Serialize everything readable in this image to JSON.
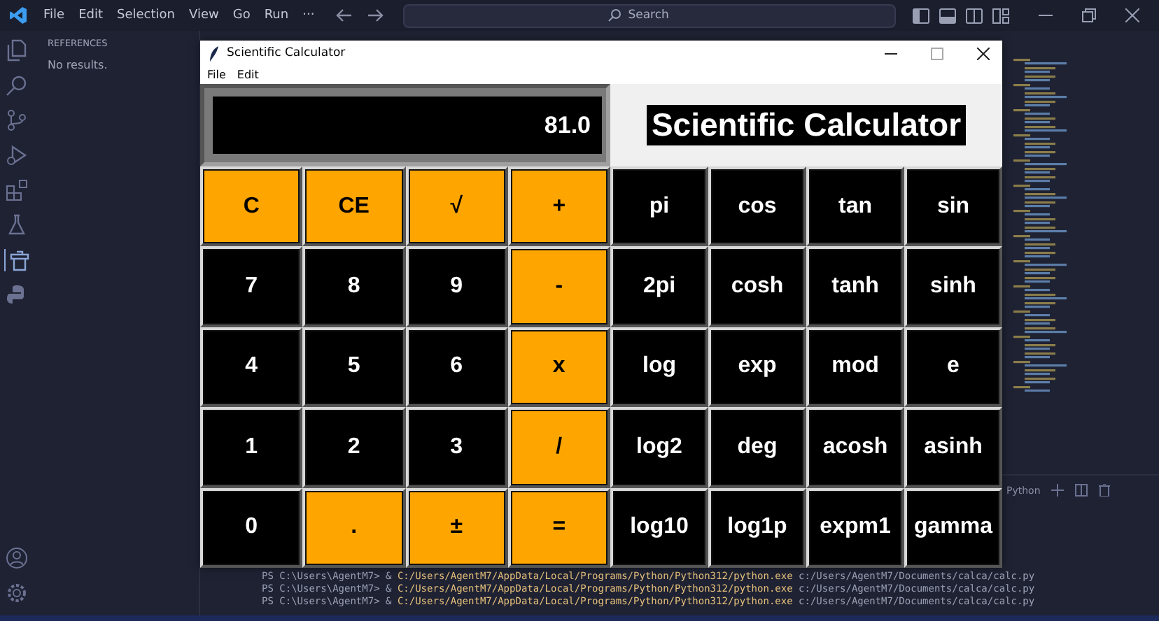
{
  "editor": {
    "menu": [
      "File",
      "Edit",
      "Selection",
      "View",
      "Go",
      "Run",
      "···"
    ],
    "search_placeholder": "Search",
    "sidebar": {
      "title": "REFERENCES",
      "message": "No results."
    },
    "terminal": {
      "panel_title": "Python",
      "lines": [
        {
          "prompt": "PS C:\\Users\\AgentM7> & ",
          "exe": "C:/Users/AgentM7/AppData/Local/Programs/Python/Python312/python.exe",
          "arg": "c:/Users/AgentM7/Documents/calca/calc.py"
        },
        {
          "prompt": "PS C:\\Users\\AgentM7> & ",
          "exe": "C:/Users/AgentM7/AppData/Local/Programs/Python/Python312/python.exe",
          "arg": "c:/Users/AgentM7/Documents/calca/calc.py"
        },
        {
          "prompt": "PS C:\\Users\\AgentM7> & ",
          "exe": "C:/Users/AgentM7/AppData/Local/Programs/Python/Python312/python.exe",
          "arg": "c:/Users/AgentM7/Documents/calca/calc.py"
        }
      ]
    }
  },
  "calculator": {
    "title": "Scientific Calculator",
    "menu": [
      "File",
      "Edit"
    ],
    "display": "81.0",
    "heading": "Scientific Calculator",
    "keys": [
      {
        "label": "C",
        "kind": "accent"
      },
      {
        "label": "CE",
        "kind": "accent"
      },
      {
        "label": "√",
        "kind": "accent"
      },
      {
        "label": "+",
        "kind": "accent"
      },
      {
        "label": "pi",
        "kind": "plain"
      },
      {
        "label": "cos",
        "kind": "plain"
      },
      {
        "label": "tan",
        "kind": "plain"
      },
      {
        "label": "sin",
        "kind": "plain"
      },
      {
        "label": "7",
        "kind": "plain"
      },
      {
        "label": "8",
        "kind": "plain"
      },
      {
        "label": "9",
        "kind": "plain"
      },
      {
        "label": "-",
        "kind": "accent"
      },
      {
        "label": "2pi",
        "kind": "plain"
      },
      {
        "label": "cosh",
        "kind": "plain"
      },
      {
        "label": "tanh",
        "kind": "plain"
      },
      {
        "label": "sinh",
        "kind": "plain"
      },
      {
        "label": "4",
        "kind": "plain"
      },
      {
        "label": "5",
        "kind": "plain"
      },
      {
        "label": "6",
        "kind": "plain"
      },
      {
        "label": "x",
        "kind": "accent"
      },
      {
        "label": "log",
        "kind": "plain"
      },
      {
        "label": "exp",
        "kind": "plain"
      },
      {
        "label": "mod",
        "kind": "plain"
      },
      {
        "label": "e",
        "kind": "plain"
      },
      {
        "label": "1",
        "kind": "plain"
      },
      {
        "label": "2",
        "kind": "plain"
      },
      {
        "label": "3",
        "kind": "plain"
      },
      {
        "label": "/",
        "kind": "accent"
      },
      {
        "label": "log2",
        "kind": "plain"
      },
      {
        "label": "deg",
        "kind": "plain"
      },
      {
        "label": "acosh",
        "kind": "plain"
      },
      {
        "label": "asinh",
        "kind": "plain"
      },
      {
        "label": "0",
        "kind": "plain"
      },
      {
        "label": ".",
        "kind": "accent"
      },
      {
        "label": "±",
        "kind": "accent"
      },
      {
        "label": "=",
        "kind": "accent"
      },
      {
        "label": "log10",
        "kind": "plain"
      },
      {
        "label": "log1p",
        "kind": "plain"
      },
      {
        "label": "expm1",
        "kind": "plain"
      },
      {
        "label": "gamma",
        "kind": "plain"
      }
    ]
  }
}
